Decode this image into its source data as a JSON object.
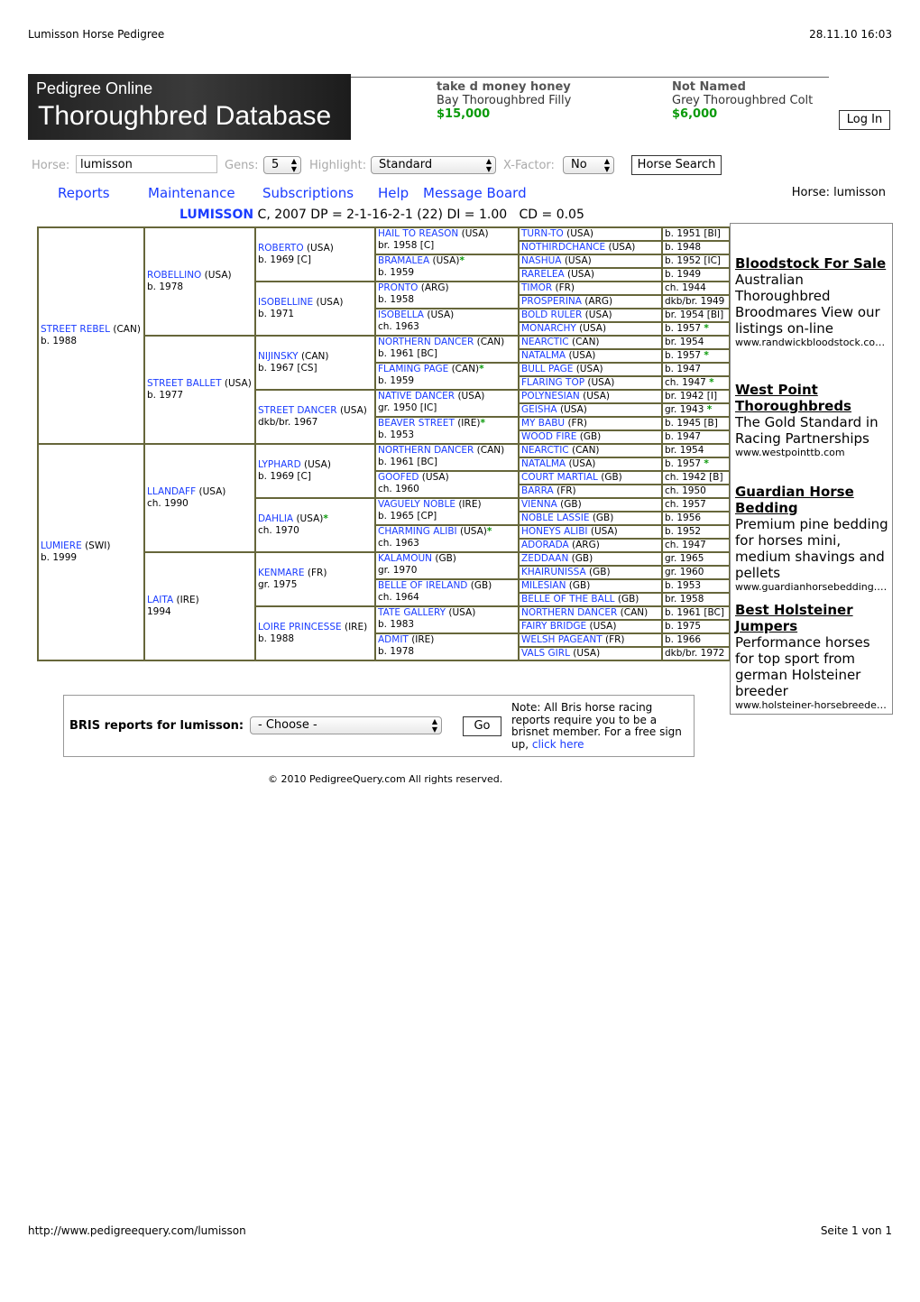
{
  "print_header": {
    "title": "Lumisson Horse Pedigree",
    "datetime": "28.11.10 16:03"
  },
  "banner": {
    "small": "Pedigree Online",
    "big": "Thoroughbred Database"
  },
  "ads": [
    {
      "title": "take d money honey",
      "desc": "Bay Thoroughbred Filly",
      "price": "$15,000"
    },
    {
      "title": "Not Named",
      "desc": "Grey Thoroughbred Colt",
      "price": "$6,000"
    }
  ],
  "login_label": "Log In",
  "search": {
    "horse_label": "Horse:",
    "horse_value": "lumisson",
    "gens_label": "Gens:",
    "gens_value": "5",
    "highlight_label": "Highlight:",
    "highlight_value": "Standard",
    "xfactor_label": "X-Factor:",
    "xfactor_value": "No",
    "button": "Horse Search"
  },
  "nav": [
    "Reports",
    "Maintenance",
    "Subscriptions",
    "Help",
    "Message Board"
  ],
  "current_horse": "Horse: lumisson",
  "summary": {
    "name": "LUMISSON",
    "rest": " C, 2007 DP = 2-1-16-2-1 (22) DI = 1.00   CD = 0.05"
  },
  "pedigree": {
    "gen1": [
      {
        "n": "STREET REBEL",
        "c": "(CAN)",
        "i": "b. 1988"
      },
      {
        "n": "LUMIERE",
        "c": "(SWI)",
        "i": "b. 1999"
      }
    ],
    "gen2": [
      {
        "n": "ROBELLINO",
        "c": "(USA)",
        "i": "b. 1978"
      },
      {
        "n": "STREET BALLET",
        "c": "(USA)",
        "i": "b. 1977"
      },
      {
        "n": "LLANDAFF",
        "c": "(USA)",
        "i": "ch. 1990"
      },
      {
        "n": "LAITA",
        "c": "(IRE)",
        "i": "1994"
      }
    ],
    "gen3": [
      {
        "n": "ROBERTO",
        "c": "(USA)",
        "i": "b. 1969 [C]"
      },
      {
        "n": "ISOBELLINE",
        "c": "(USA)",
        "i": "b. 1971"
      },
      {
        "n": "NIJINSKY",
        "c": "(CAN)",
        "i": "b. 1967 [CS]"
      },
      {
        "n": "STREET DANCER",
        "c": "(USA)",
        "i": "dkb/br. 1967"
      },
      {
        "n": "LYPHARD",
        "c": "(USA)",
        "i": "b. 1969 [C]"
      },
      {
        "n": "DAHLIA",
        "c": "(USA)",
        "i": "ch. 1970",
        "s": true
      },
      {
        "n": "KENMARE",
        "c": "(FR)",
        "i": "gr. 1975"
      },
      {
        "n": "LOIRE PRINCESSE",
        "c": "(IRE)",
        "i": "b. 1988"
      }
    ],
    "gen4": [
      {
        "n": "HAIL TO REASON",
        "c": "(USA)",
        "i": "br. 1958 [C]"
      },
      {
        "n": "BRAMALEA",
        "c": "(USA)",
        "i": "b. 1959",
        "s": true
      },
      {
        "n": "PRONTO",
        "c": "(ARG)",
        "i": "b. 1958"
      },
      {
        "n": "ISOBELLA",
        "c": "(USA)",
        "i": "ch. 1963"
      },
      {
        "n": "NORTHERN DANCER",
        "c": "(CAN)",
        "i": "b. 1961 [BC]"
      },
      {
        "n": "FLAMING PAGE",
        "c": "(CAN)",
        "i": "b. 1959",
        "s": true
      },
      {
        "n": "NATIVE DANCER",
        "c": "(USA)",
        "i": "gr. 1950 [IC]"
      },
      {
        "n": "BEAVER STREET",
        "c": "(IRE)",
        "i": "b. 1953",
        "s": true
      },
      {
        "n": "NORTHERN DANCER",
        "c": "(CAN)",
        "i": "b. 1961 [BC]"
      },
      {
        "n": "GOOFED",
        "c": "(USA)",
        "i": "ch. 1960"
      },
      {
        "n": "VAGUELY NOBLE",
        "c": "(IRE)",
        "i": "b. 1965 [CP]"
      },
      {
        "n": "CHARMING ALIBI",
        "c": "(USA)",
        "i": "ch. 1963",
        "s": true
      },
      {
        "n": "KALAMOUN",
        "c": "(GB)",
        "i": "gr. 1970"
      },
      {
        "n": "BELLE OF IRELAND",
        "c": "(GB)",
        "i": "ch. 1964"
      },
      {
        "n": "TATE GALLERY",
        "c": "(USA)",
        "i": "b. 1983"
      },
      {
        "n": "ADMIT",
        "c": "(IRE)",
        "i": "b. 1978"
      }
    ],
    "gen5": [
      {
        "n": "TURN-TO",
        "c": "(USA)",
        "i": "b. 1951 [BI]"
      },
      {
        "n": "NOTHIRDCHANCE",
        "c": "(USA)",
        "i": "b. 1948"
      },
      {
        "n": "NASHUA",
        "c": "(USA)",
        "i": "b. 1952 [IC]"
      },
      {
        "n": "RARELEA",
        "c": "(USA)",
        "i": "b. 1949"
      },
      {
        "n": "TIMOR",
        "c": "(FR)",
        "i": "ch. 1944"
      },
      {
        "n": "PROSPERINA",
        "c": "(ARG)",
        "i": "dkb/br. 1949"
      },
      {
        "n": "BOLD RULER",
        "c": "(USA)",
        "i": "br. 1954 [BI]"
      },
      {
        "n": "MONARCHY",
        "c": "(USA)",
        "i": "b. 1957",
        "s": true
      },
      {
        "n": "NEARCTIC",
        "c": "(CAN)",
        "i": "br. 1954"
      },
      {
        "n": "NATALMA",
        "c": "(USA)",
        "i": "b. 1957",
        "s": true
      },
      {
        "n": "BULL PAGE",
        "c": "(USA)",
        "i": "b. 1947"
      },
      {
        "n": "FLARING TOP",
        "c": "(USA)",
        "i": "ch. 1947",
        "s": true
      },
      {
        "n": "POLYNESIAN",
        "c": "(USA)",
        "i": "br. 1942 [I]"
      },
      {
        "n": "GEISHA",
        "c": "(USA)",
        "i": "gr. 1943",
        "s": true
      },
      {
        "n": "MY BABU",
        "c": "(FR)",
        "i": "b. 1945 [B]"
      },
      {
        "n": "WOOD FIRE",
        "c": "(GB)",
        "i": "b. 1947"
      },
      {
        "n": "NEARCTIC",
        "c": "(CAN)",
        "i": "br. 1954"
      },
      {
        "n": "NATALMA",
        "c": "(USA)",
        "i": "b. 1957",
        "s": true
      },
      {
        "n": "COURT MARTIAL",
        "c": "(GB)",
        "i": "ch. 1942 [B]"
      },
      {
        "n": "BARRA",
        "c": "(FR)",
        "i": "ch. 1950"
      },
      {
        "n": "VIENNA",
        "c": "(GB)",
        "i": "ch. 1957"
      },
      {
        "n": "NOBLE LASSIE",
        "c": "(GB)",
        "i": "b. 1956"
      },
      {
        "n": "HONEYS ALIBI",
        "c": "(USA)",
        "i": "b. 1952"
      },
      {
        "n": "ADORADA",
        "c": "(ARG)",
        "i": "ch. 1947"
      },
      {
        "n": "ZEDDAAN",
        "c": "(GB)",
        "i": "gr. 1965"
      },
      {
        "n": "KHAIRUNISSA",
        "c": "(GB)",
        "i": "gr. 1960"
      },
      {
        "n": "MILESIAN",
        "c": "(GB)",
        "i": "b. 1953"
      },
      {
        "n": "BELLE OF THE BALL",
        "c": "(GB)",
        "i": "br. 1958"
      },
      {
        "n": "NORTHERN DANCER",
        "c": "(CAN)",
        "i": "b. 1961 [BC]"
      },
      {
        "n": "FAIRY BRIDGE",
        "c": "(USA)",
        "i": "b. 1975"
      },
      {
        "n": "WELSH PAGEANT",
        "c": "(FR)",
        "i": "b. 1966"
      },
      {
        "n": "VALS GIRL",
        "c": "(USA)",
        "i": "dkb/br. 1972"
      }
    ]
  },
  "sidebar_ads": [
    {
      "title": "Bloodstock For Sale",
      "desc": "Australian Thoroughbred Broodmares View our listings on-line",
      "url": "www.randwickbloodstock.com.au"
    },
    {
      "title": "West Point Thoroughbreds",
      "desc": "The Gold Standard in Racing Partnerships",
      "url": "www.westpointtb.com"
    },
    {
      "title": "Guardian Horse Bedding",
      "desc": "Premium pine bedding for horses mini, medium shavings and pellets",
      "url": "www.guardianhorsebedding.com"
    },
    {
      "title": "Best Holsteiner Jumpers",
      "desc": "Performance horses for top sport from german Holsteiner breeder",
      "url": "www.holsteiner-horsebreeder.com"
    }
  ],
  "bris": {
    "label": "BRIS reports for lumisson:",
    "select": "- Choose -",
    "go": "Go",
    "note": "Note: All Bris horse racing reports require you to be a brisnet member. For a free sign up, ",
    "link": "click here"
  },
  "copyright": "© 2010 PedigreeQuery.com All rights reserved.",
  "print_footer": {
    "url": "http://www.pedigreequery.com/lumisson",
    "page": "Seite 1 von 1"
  }
}
